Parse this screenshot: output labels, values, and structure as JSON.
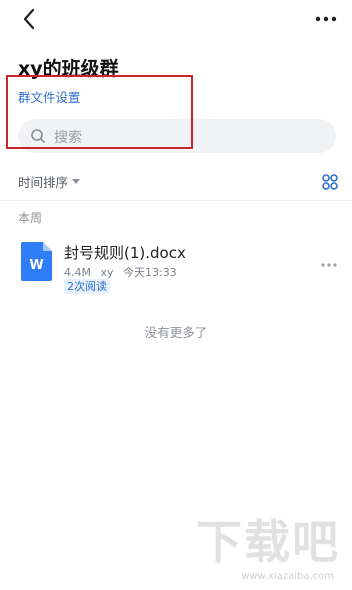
{
  "header": {
    "title": "xy的班级群",
    "settings_link": "群文件设置"
  },
  "search": {
    "placeholder": "搜索"
  },
  "toolbar": {
    "sort_label": "时间排序"
  },
  "sections": [
    {
      "label": "本周",
      "files": [
        {
          "name": "封号规则(1).docx",
          "size": "4.4M",
          "uploader": "xy",
          "time": "今天13:33",
          "read_count": "2次阅读",
          "icon": "word-doc-icon",
          "icon_letter": "W"
        }
      ]
    }
  ],
  "footer": {
    "no_more": "没有更多了"
  },
  "watermark": {
    "logo": "下载吧",
    "url": "www.xiazaiba.com"
  },
  "colors": {
    "accent": "#2f6fcb",
    "highlight_box": "#c8242b",
    "doc_icon": "#2f7df6"
  }
}
